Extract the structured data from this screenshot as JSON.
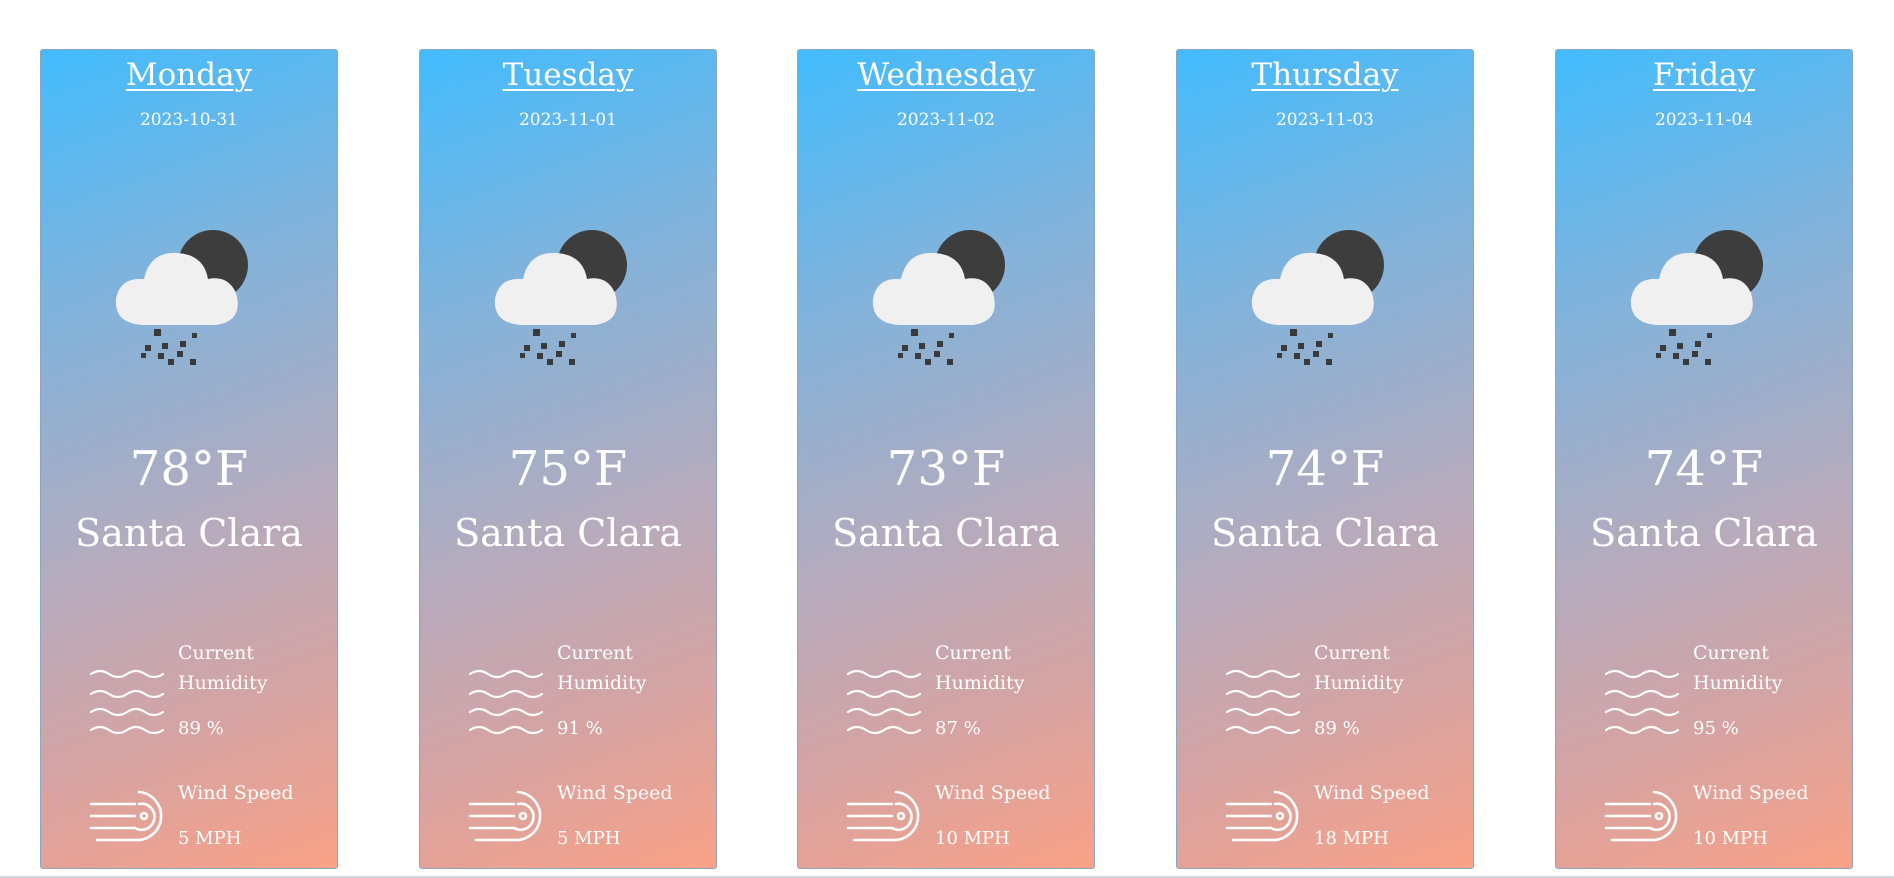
{
  "forecast": {
    "days": [
      {
        "day": "Monday",
        "date": "2023-10-31",
        "temp": "78°F",
        "city": "Santa Clara",
        "humidity_label": "Current Humidity",
        "humidity": "89 %",
        "wind_label": "Wind Speed",
        "wind": "5 MPH",
        "icon": "cloud-night-rain-icon"
      },
      {
        "day": "Tuesday",
        "date": "2023-11-01",
        "temp": "75°F",
        "city": "Santa Clara",
        "humidity_label": "Current Humidity",
        "humidity": "91 %",
        "wind_label": "Wind Speed",
        "wind": "5 MPH",
        "icon": "cloud-night-rain-icon"
      },
      {
        "day": "Wednesday",
        "date": "2023-11-02",
        "temp": "73°F",
        "city": "Santa Clara",
        "humidity_label": "Current Humidity",
        "humidity": "87 %",
        "wind_label": "Wind Speed",
        "wind": "10 MPH",
        "icon": "cloud-night-rain-icon"
      },
      {
        "day": "Thursday",
        "date": "2023-11-03",
        "temp": "74°F",
        "city": "Santa Clara",
        "humidity_label": "Current Humidity",
        "humidity": "89 %",
        "wind_label": "Wind Speed",
        "wind": "18 MPH",
        "icon": "cloud-night-rain-icon"
      },
      {
        "day": "Friday",
        "date": "2023-11-04",
        "temp": "74°F",
        "city": "Santa Clara",
        "humidity_label": "Current Humidity",
        "humidity": "95 %",
        "wind_label": "Wind Speed",
        "wind": "10 MPH",
        "icon": "cloud-night-rain-icon"
      }
    ]
  },
  "colors": {
    "gradient_top": "#42bcfd",
    "gradient_bottom": "#f9a287",
    "text": "#ffffff",
    "cloud": "#f0f0f0",
    "moon": "#3d3d3d"
  }
}
